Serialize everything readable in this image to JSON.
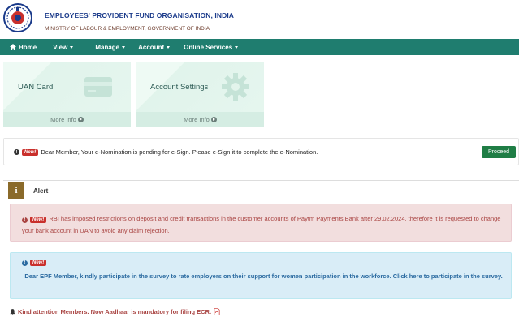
{
  "header": {
    "org_title": "EMPLOYEES' PROVIDENT FUND ORGANISATION, INDIA",
    "ministry": "MINISTRY OF LABOUR & EMPLOYMENT, GOVERNMENT OF INDIA",
    "logo_icon": "epfo-emblem-icon"
  },
  "navbar": {
    "items": [
      {
        "label": "Home",
        "icon": "home-icon"
      },
      {
        "label": "View"
      },
      {
        "label": "Manage"
      },
      {
        "label": "Account"
      },
      {
        "label": "Online Services"
      }
    ],
    "color": "#1f7d6f"
  },
  "cards": [
    {
      "title": "UAN Card",
      "more": "More Info",
      "icon": "card-icon"
    },
    {
      "title": "Account Settings",
      "more": "More Info",
      "icon": "gear-icon"
    }
  ],
  "nomination": {
    "badge": "New!",
    "message": "Dear Member, Your e-Nomination is pending for e-Sign. Please e-Sign it to complete the e-Nomination.",
    "button": "Proceed"
  },
  "alert": {
    "tab_label": "Alert",
    "tab_icon_text": "i",
    "red": {
      "badge": "New!",
      "message": "RBI has imposed restrictions on deposit and credit transactions in the customer accounts of Paytm Payments Bank after 29.02.2024, therefore it is requested to change your bank account in UAN to avoid any claim rejection."
    },
    "blue": {
      "badge": "New!",
      "message": "Dear EPF Member, kindly participate in the survey to rate employers on their support for women participation in the workforce. Click here to participate in the survey."
    },
    "aadhaar": "Kind attention Members. Now Aadhaar is mandatory for filing ECR."
  }
}
